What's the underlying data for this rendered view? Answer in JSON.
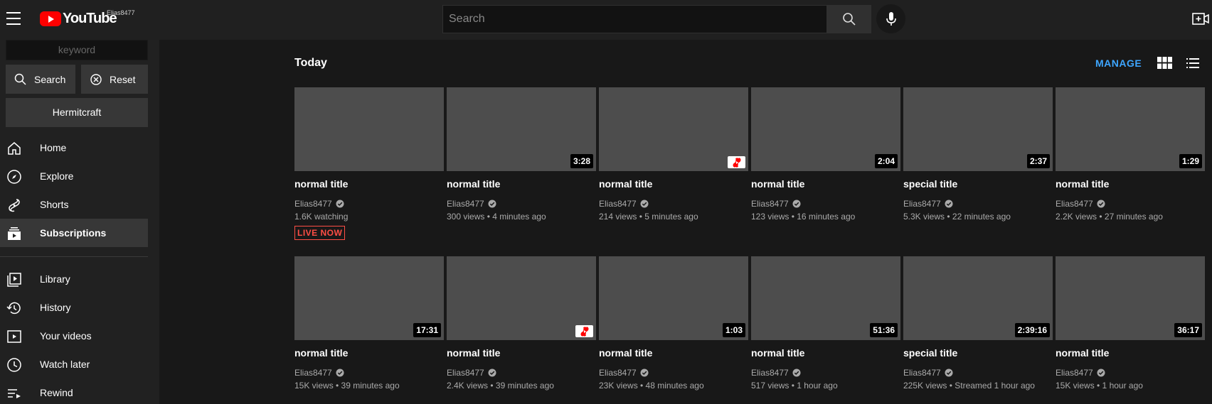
{
  "header": {
    "logo_text": "YouTube",
    "user_tag": "Elias8477",
    "search_placeholder": "Search"
  },
  "sidebar": {
    "keyword_placeholder": "keyword",
    "search_label": "Search",
    "reset_label": "Reset",
    "filter_label": "Hermitcraft",
    "items": [
      {
        "label": "Home",
        "icon": "home-icon"
      },
      {
        "label": "Explore",
        "icon": "compass-icon"
      },
      {
        "label": "Shorts",
        "icon": "shorts-icon"
      },
      {
        "label": "Subscriptions",
        "icon": "subscriptions-icon",
        "active": true
      },
      {
        "label": "Library",
        "icon": "library-icon"
      },
      {
        "label": "History",
        "icon": "history-icon"
      },
      {
        "label": "Your videos",
        "icon": "your-videos-icon"
      },
      {
        "label": "Watch later",
        "icon": "watch-later-icon"
      },
      {
        "label": "Rewind",
        "icon": "rewind-icon"
      }
    ]
  },
  "main": {
    "section_title": "Today",
    "manage_label": "MANAGE",
    "videos": [
      {
        "title": "normal title",
        "channel": "Elias8477",
        "meta": "1.6K watching",
        "live": "LIVE NOW",
        "badge": ""
      },
      {
        "title": "normal title",
        "channel": "Elias8477",
        "meta": "300 views • 4 minutes ago",
        "badge": "3:28"
      },
      {
        "title": "normal title",
        "channel": "Elias8477",
        "meta": "214 views • 5 minutes ago",
        "badge": "shorts"
      },
      {
        "title": "normal title",
        "channel": "Elias8477",
        "meta": "123 views • 16 minutes ago",
        "badge": "2:04"
      },
      {
        "title": "special title",
        "channel": "Elias8477",
        "meta": "5.3K views • 22 minutes ago",
        "badge": "2:37"
      },
      {
        "title": "normal title",
        "channel": "Elias8477",
        "meta": "2.2K views • 27 minutes ago",
        "badge": "1:29"
      },
      {
        "title": "normal title",
        "channel": "Elias8477",
        "meta": "15K views • 39 minutes ago",
        "badge": "17:31"
      },
      {
        "title": "normal title",
        "channel": "Elias8477",
        "meta": "2.4K views • 39 minutes ago",
        "badge": "shorts"
      },
      {
        "title": "normal title",
        "channel": "Elias8477",
        "meta": "23K views • 48 minutes ago",
        "badge": "1:03"
      },
      {
        "title": "normal title",
        "channel": "Elias8477",
        "meta": "517 views • 1 hour ago",
        "badge": "51:36"
      },
      {
        "title": "special title",
        "channel": "Elias8477",
        "meta": "225K views • Streamed 1 hour ago",
        "badge": "2:39:16"
      },
      {
        "title": "normal title",
        "channel": "Elias8477",
        "meta": "15K views • 1 hour ago",
        "badge": "36:17"
      }
    ]
  },
  "colors": {
    "background": "#181818",
    "header": "#202020",
    "sidebar": "#212121",
    "accent": "#3ea6ff",
    "live": "#ff4e45",
    "brand": "#ff0000"
  }
}
